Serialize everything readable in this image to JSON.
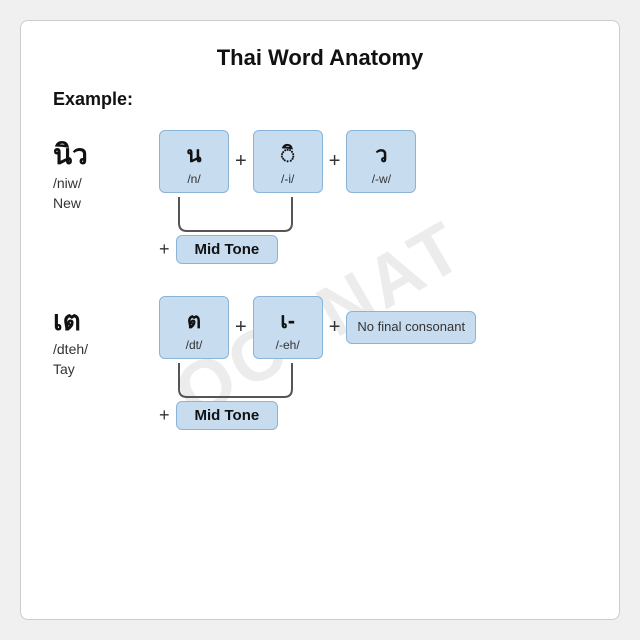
{
  "card": {
    "title": "Thai Word Anatomy",
    "example_label": "Example:",
    "watermark": "OCTNAT"
  },
  "words": [
    {
      "thai": "นิว",
      "roman": "/niw/",
      "english": "New",
      "boxes": [
        {
          "thai": "น",
          "roman": "/n/"
        },
        {
          "thai": "◌ิ",
          "roman": "/-i/"
        },
        {
          "thai": "ว",
          "roman": "/-w/"
        }
      ],
      "midtone": "Mid Tone"
    },
    {
      "thai": "เต",
      "roman": "/dteh/",
      "english": "Tay",
      "boxes": [
        {
          "thai": "ต",
          "roman": "/dt/"
        },
        {
          "thai": "เ-",
          "roman": "/-eh/"
        },
        {
          "text": "No final consonant"
        }
      ],
      "midtone": "Mid Tone"
    }
  ]
}
